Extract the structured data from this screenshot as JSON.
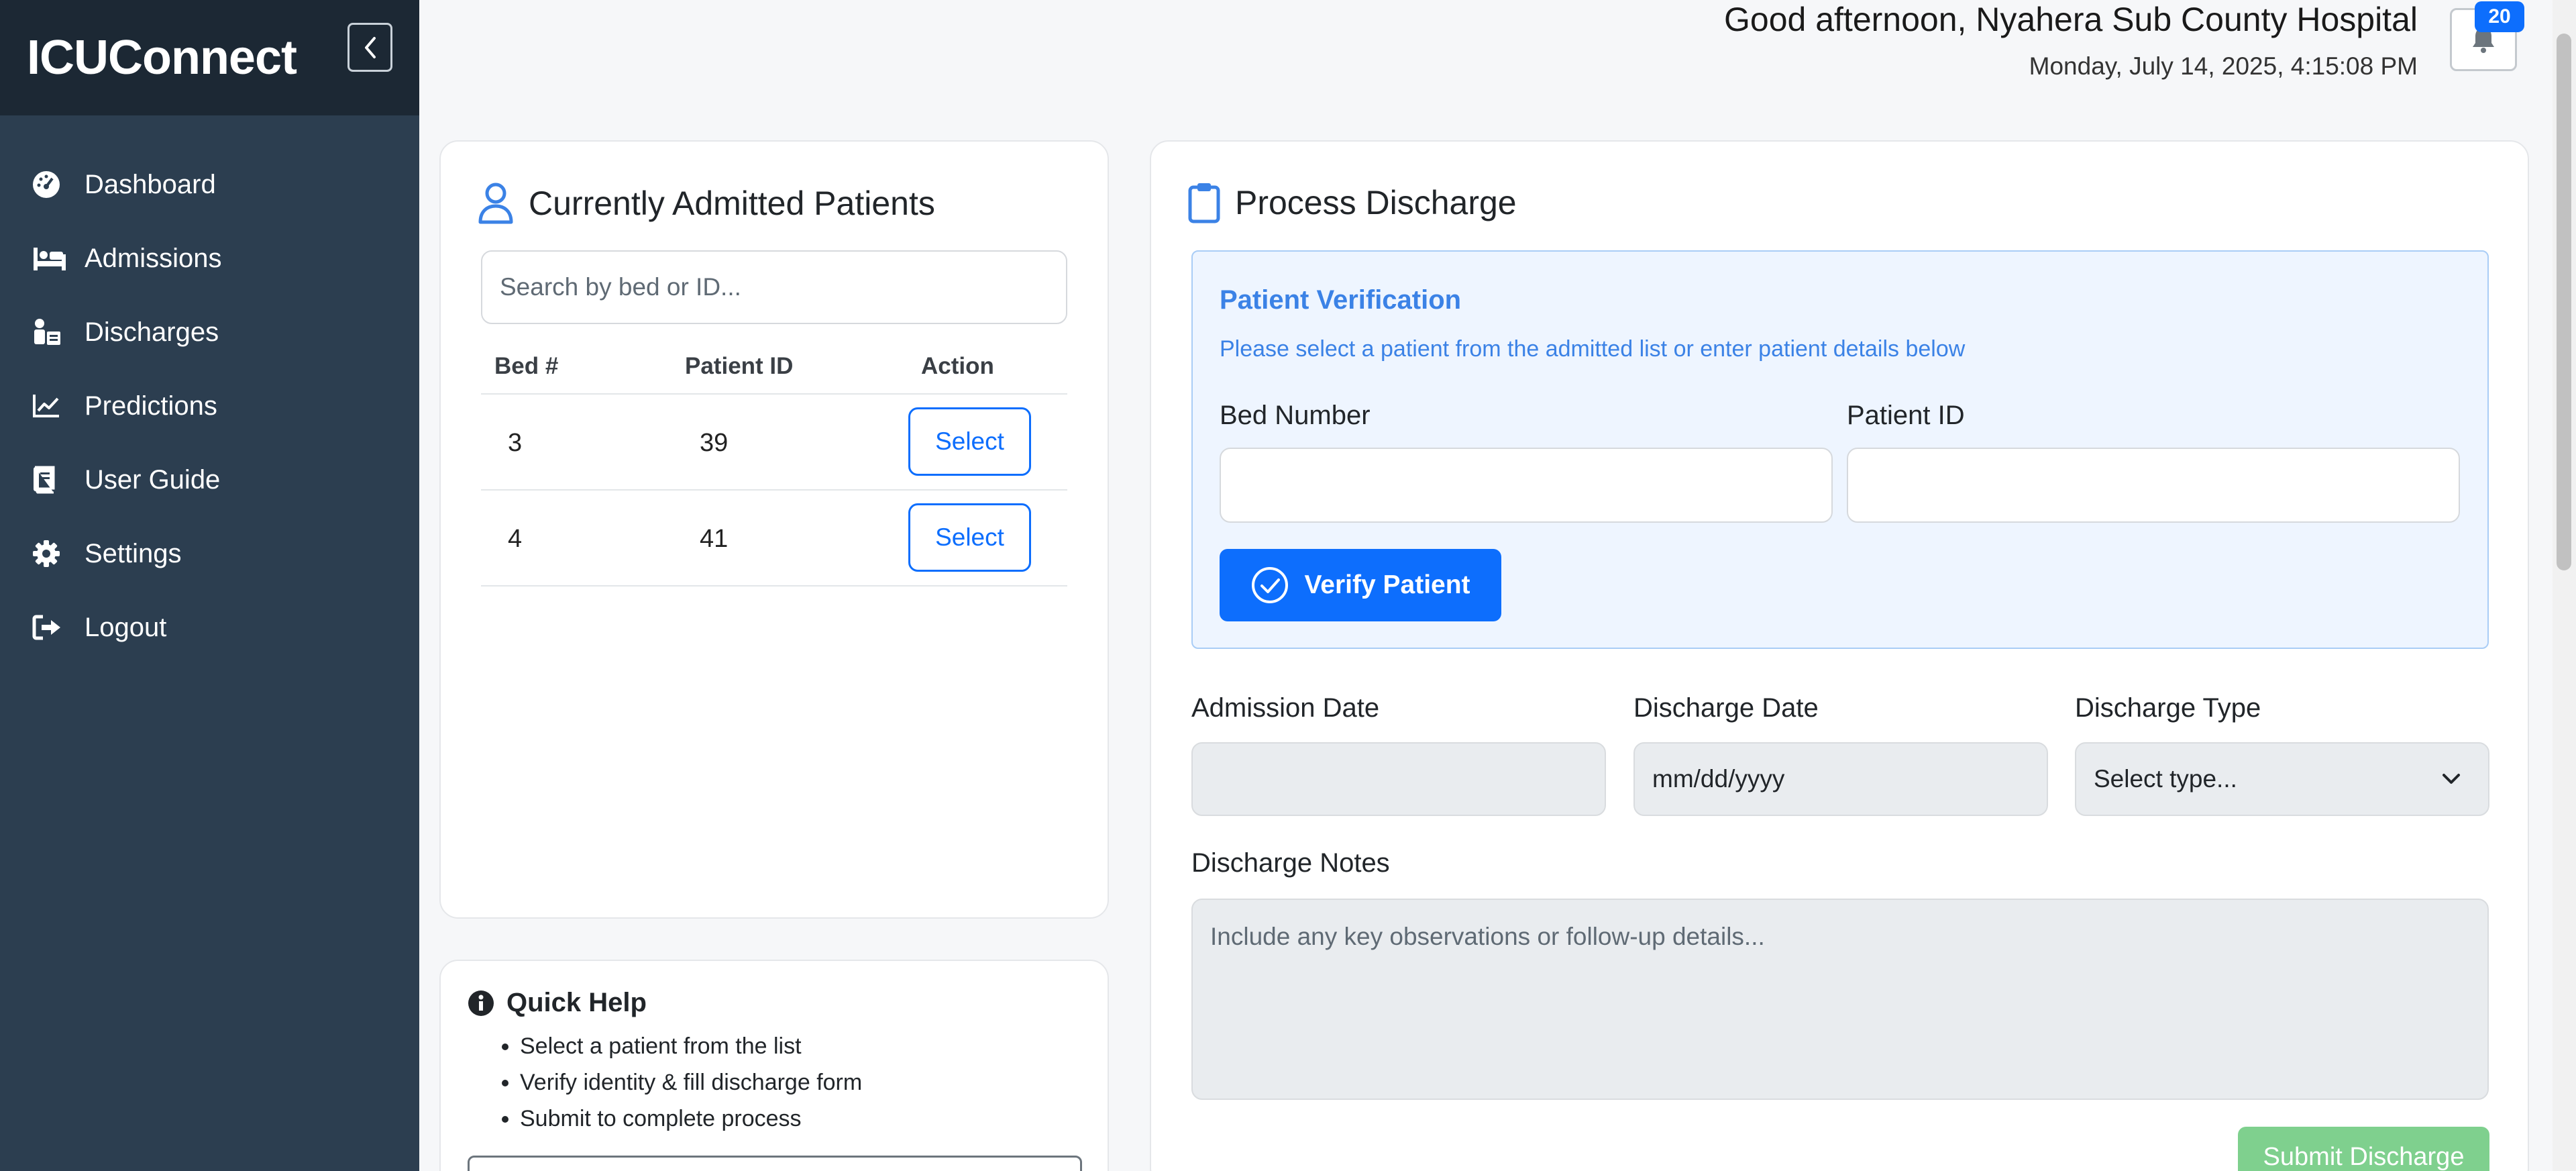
{
  "app": {
    "name": "ICUConnect"
  },
  "sidebar": {
    "items": [
      {
        "label": "Dashboard",
        "icon": "dashboard-gauge-icon"
      },
      {
        "label": "Admissions",
        "icon": "bed-icon"
      },
      {
        "label": "Discharges",
        "icon": "discharge-icon"
      },
      {
        "label": "Predictions",
        "icon": "chart-line-icon"
      },
      {
        "label": "User Guide",
        "icon": "book-icon"
      },
      {
        "label": "Settings",
        "icon": "gear-icon"
      },
      {
        "label": "Logout",
        "icon": "logout-icon"
      }
    ]
  },
  "header": {
    "greeting": "Good afternoon, Nyahera Sub County Hospital",
    "datetime": "Monday, July 14, 2025, 4:15:08 PM",
    "notification_count": "20"
  },
  "admitted": {
    "title": "Currently Admitted Patients",
    "search_placeholder": "Search by bed or ID...",
    "columns": [
      "Bed #",
      "Patient ID",
      "Action"
    ],
    "rows": [
      {
        "bed": "3",
        "patient_id": "39",
        "action": "Select"
      },
      {
        "bed": "4",
        "patient_id": "41",
        "action": "Select"
      }
    ]
  },
  "help": {
    "title": "Quick Help",
    "items": [
      "Select a patient from the list",
      "Verify identity & fill discharge form",
      "Submit to complete process"
    ]
  },
  "discharge": {
    "title": "Process Discharge",
    "verification": {
      "title": "Patient Verification",
      "subtitle": "Please select a patient from the admitted list or enter patient details below",
      "bed_label": "Bed Number",
      "bed_value": "",
      "patient_label": "Patient ID",
      "patient_value": "",
      "verify_button": "Verify Patient"
    },
    "admission_date_label": "Admission Date",
    "admission_date_value": "",
    "discharge_date_label": "Discharge Date",
    "discharge_date_placeholder": "mm/dd/yyyy",
    "discharge_type_label": "Discharge Type",
    "discharge_type_value": "Select type...",
    "notes_label": "Discharge Notes",
    "notes_placeholder": "Include any key observations or follow-up details...",
    "submit_button": "Submit Discharge"
  },
  "colors": {
    "sidebar": "#2c3e50",
    "brand_bar": "#1c2834",
    "primary": "#0d6efd",
    "verify_bg": "#eef5ff",
    "submit": "#7fd08e"
  }
}
